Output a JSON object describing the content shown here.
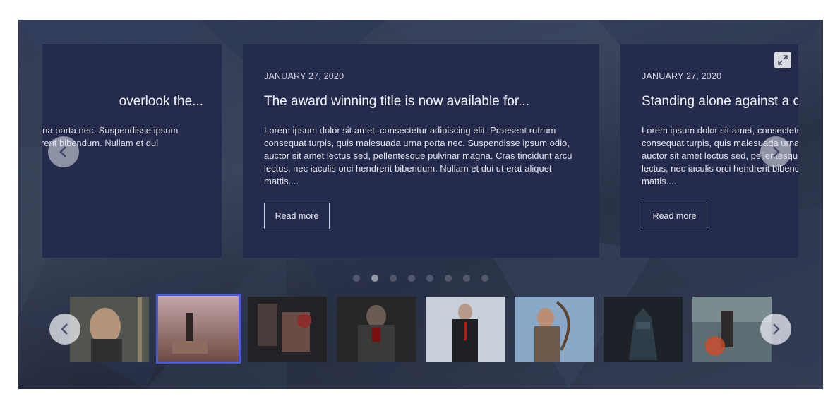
{
  "cards": [
    {
      "title": "overlook the...",
      "excerpt": "etur adipiscing elit. Praesent rutrum na porta nec. Suspendisse ipsum ntesque pulvinar magna. Cras hendrerit bibendum. Nullam et dui",
      "date": ""
    },
    {
      "date": "JANUARY 27, 2020",
      "title": "The award winning title is now available for...",
      "excerpt": "Lorem ipsum dolor sit amet, consectetur adipiscing elit. Praesent rutrum consequat turpis, quis malesuada urna porta nec. Suspendisse ipsum odio, auctor sit amet lectus sed, pellentesque pulvinar magna. Cras tincidunt arcu lectus, nec iaculis orci hendrerit bibendum. Nullam et dui ut erat aliquet mattis....",
      "read_more": "Read more"
    },
    {
      "date": "JANUARY 27, 2020",
      "title": "Standing alone against a ci",
      "excerpt": "Lorem ipsum dolor sit amet, consectetur adipiscing elit. Praesent rutrum consequat turpis, quis malesuada urna porta nec. Suspendisse ipsum odio, auctor sit amet lectus sed, pellentesque pulvinar magna. Cras tincidunt arcu lectus, nec iaculis orci hendrerit bibendum. Nullam et dui ut erat aliquet mattis....",
      "read_more": "Read more"
    }
  ],
  "slider": {
    "dot_count": 8,
    "active_dot": 2
  },
  "thumbnails": {
    "count": 8,
    "active": 2
  },
  "icons": {
    "expand": "expand-icon",
    "prev": "chevron-left-icon",
    "next": "chevron-right-icon"
  },
  "colors": {
    "card_bg": "#252b4c",
    "active_thumb_border": "#4a5bd1"
  }
}
